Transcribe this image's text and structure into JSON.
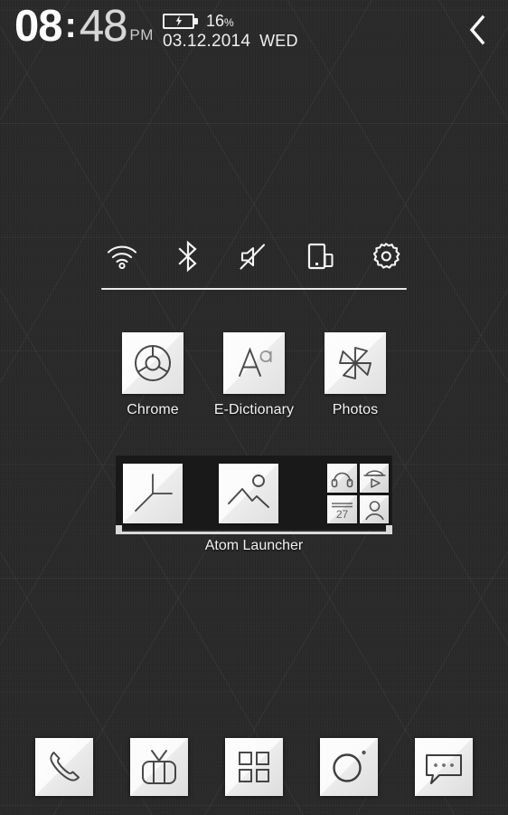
{
  "statusbar": {
    "clock": {
      "hours": "08",
      "separator": ":",
      "minutes": "48",
      "meridiem": "PM"
    },
    "battery": {
      "percent": "16",
      "unit": "%",
      "icon": "battery-charging-icon",
      "charging": true
    },
    "date": {
      "value": "03.12.2014",
      "weekday": "WED"
    },
    "back_icon": "chevron-left-icon"
  },
  "toggles": [
    {
      "id": "wifi",
      "icon": "wifi-icon",
      "label": "Wi-Fi"
    },
    {
      "id": "bluetooth",
      "icon": "bluetooth-icon",
      "label": "Bluetooth"
    },
    {
      "id": "mute",
      "icon": "volume-mute-icon",
      "label": "Mute"
    },
    {
      "id": "rotation",
      "icon": "screen-rotate-icon",
      "label": "Auto-rotate"
    },
    {
      "id": "settings",
      "icon": "gear-icon",
      "label": "Settings"
    }
  ],
  "apps": [
    {
      "label": "Chrome",
      "icon": "chrome-icon"
    },
    {
      "label": "E-Dictionary",
      "icon": "letter-aa-icon"
    },
    {
      "label": "Photos",
      "icon": "pinwheel-icon"
    }
  ],
  "folder": {
    "label": "Atom Launcher",
    "items": [
      {
        "name": "clock",
        "icon": "analog-clock-icon"
      },
      {
        "name": "gallery",
        "icon": "mountain-photo-icon"
      }
    ],
    "mini_folder": [
      {
        "name": "music",
        "icon": "headphones-icon"
      },
      {
        "name": "video",
        "icon": "video-play-icon"
      },
      {
        "name": "calendar",
        "icon": "calendar-icon",
        "day": "27"
      },
      {
        "name": "contacts",
        "icon": "person-icon"
      }
    ]
  },
  "dock": [
    {
      "name": "phone",
      "icon": "phone-handset-icon"
    },
    {
      "name": "browser",
      "icon": "tv-icon"
    },
    {
      "name": "app-drawer",
      "icon": "grid-four-squares-icon"
    },
    {
      "name": "camera",
      "icon": "camera-lens-icon"
    },
    {
      "name": "messages",
      "icon": "speech-bubble-icon"
    }
  ],
  "colors": {
    "wallpaper": "#2c2c2c",
    "tile": "#fbfbfb",
    "text": "#f2f2f2",
    "folder_bg": "#191919",
    "stroke": "#3a3a3a"
  }
}
